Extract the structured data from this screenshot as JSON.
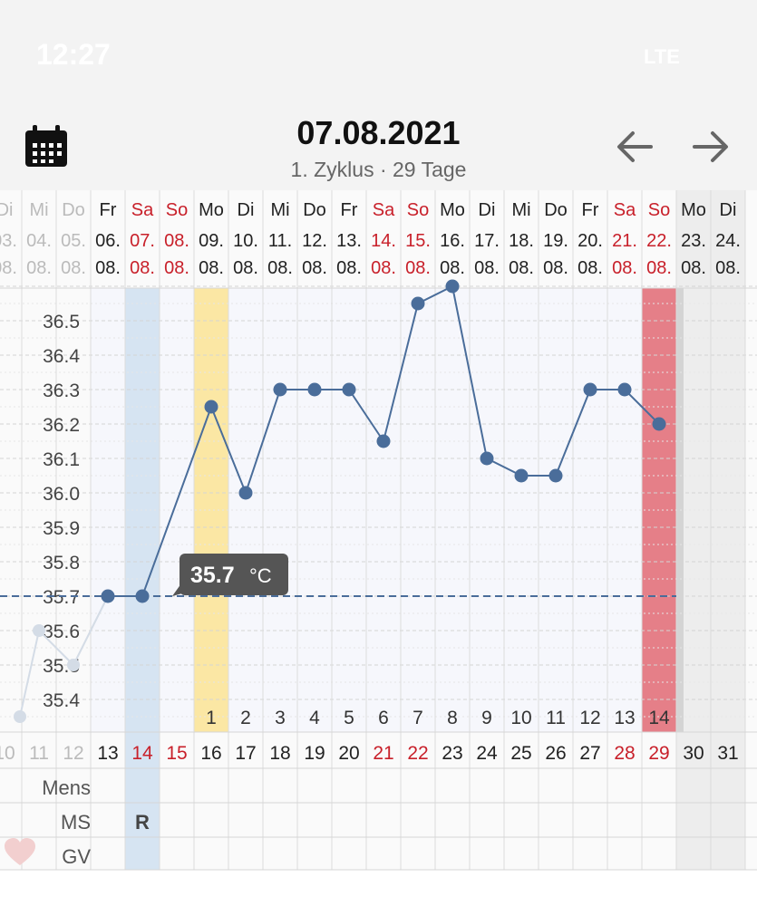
{
  "status": {
    "time": "12:27",
    "network": "LTE"
  },
  "header": {
    "title": "07.08.2021",
    "subtitle": "1. Zyklus · 29 Tage"
  },
  "colors": {
    "line": "#4a6d9a",
    "weekend": "#c8202a",
    "text": "#222222",
    "dim": "#bbbbbb",
    "yellow": "#fbe7a4",
    "red": "#e57f88",
    "blue": "#d6e4f2"
  },
  "tooltip": {
    "value": "35.7",
    "unit": "°C"
  },
  "chart_data": {
    "type": "line",
    "y_axis": {
      "ticks": [
        36.5,
        36.4,
        36.3,
        36.2,
        36.1,
        36.0,
        35.9,
        35.8,
        35.7,
        35.6,
        35.5,
        35.4
      ]
    },
    "coverline": 35.7,
    "columns": [
      {
        "dow": "Di",
        "date": "03.",
        "month": "08.",
        "day": "10",
        "dim": true
      },
      {
        "dow": "Mi",
        "date": "04.",
        "month": "08.",
        "day": "11",
        "dim": true
      },
      {
        "dow": "Do",
        "date": "05.",
        "month": "08.",
        "day": "12",
        "dim": true
      },
      {
        "dow": "Fr",
        "date": "06.",
        "month": "08.",
        "day": "13"
      },
      {
        "dow": "Sa",
        "date": "07.",
        "month": "08.",
        "day": "14",
        "weekend": true,
        "ms": "R"
      },
      {
        "dow": "So",
        "date": "08.",
        "month": "08.",
        "day": "15",
        "weekend": true
      },
      {
        "dow": "Mo",
        "date": "09.",
        "month": "08.",
        "day": "16",
        "phase": "1"
      },
      {
        "dow": "Di",
        "date": "10.",
        "month": "08.",
        "day": "17",
        "phase": "2"
      },
      {
        "dow": "Mi",
        "date": "11.",
        "month": "08.",
        "day": "18",
        "phase": "3"
      },
      {
        "dow": "Do",
        "date": "12.",
        "month": "08.",
        "day": "19",
        "phase": "4"
      },
      {
        "dow": "Fr",
        "date": "13.",
        "month": "08.",
        "day": "20",
        "phase": "5"
      },
      {
        "dow": "Sa",
        "date": "14.",
        "month": "08.",
        "day": "21",
        "weekend": true,
        "phase": "6"
      },
      {
        "dow": "So",
        "date": "15.",
        "month": "08.",
        "day": "22",
        "weekend": true,
        "phase": "7"
      },
      {
        "dow": "Mo",
        "date": "16.",
        "month": "08.",
        "day": "23",
        "phase": "8"
      },
      {
        "dow": "Di",
        "date": "17.",
        "month": "08.",
        "day": "24",
        "phase": "9"
      },
      {
        "dow": "Mi",
        "date": "18.",
        "month": "08.",
        "day": "25",
        "phase": "10"
      },
      {
        "dow": "Do",
        "date": "19.",
        "month": "08.",
        "day": "26",
        "phase": "11"
      },
      {
        "dow": "Fr",
        "date": "20.",
        "month": "08.",
        "day": "27",
        "phase": "12"
      },
      {
        "dow": "Sa",
        "date": "21.",
        "month": "08.",
        "day": "28",
        "weekend": true,
        "phase": "13"
      },
      {
        "dow": "So",
        "date": "22.",
        "month": "08.",
        "day": "29",
        "weekend": true,
        "phase": "14"
      },
      {
        "dow": "Mo",
        "date": "23.",
        "month": "08.",
        "day": "30",
        "grey": true
      },
      {
        "dow": "Di",
        "date": "24.",
        "month": "08.",
        "day": "31",
        "grey": true
      }
    ],
    "prev_cycle": [
      {
        "date": "02.08.",
        "temp": 35.35
      },
      {
        "date": "04.08.",
        "temp": 35.6
      },
      {
        "date": "05.08.",
        "temp": 35.5
      }
    ],
    "series": [
      {
        "values": [
          {
            "date": "06.08.",
            "temp": 35.7
          },
          {
            "date": "07.08.",
            "temp": 35.7
          },
          {
            "date": "09.08.",
            "temp": 36.25
          },
          {
            "date": "10.08.",
            "temp": 36.0
          },
          {
            "date": "11.08.",
            "temp": 36.3
          },
          {
            "date": "12.08.",
            "temp": 36.3
          },
          {
            "date": "13.08.",
            "temp": 36.3
          },
          {
            "date": "14.08.",
            "temp": 36.15
          },
          {
            "date": "15.08.",
            "temp": 36.55
          },
          {
            "date": "16.08.",
            "temp": 36.6
          },
          {
            "date": "17.08.",
            "temp": 36.1
          },
          {
            "date": "18.08.",
            "temp": 36.05
          },
          {
            "date": "19.08.",
            "temp": 36.05
          },
          {
            "date": "20.08.",
            "temp": 36.3
          },
          {
            "date": "21.08.",
            "temp": 36.3
          },
          {
            "date": "22.08.",
            "temp": 36.2
          }
        ]
      }
    ],
    "rows": {
      "mens": "Mens",
      "ms": "MS",
      "gv": "GV"
    }
  }
}
